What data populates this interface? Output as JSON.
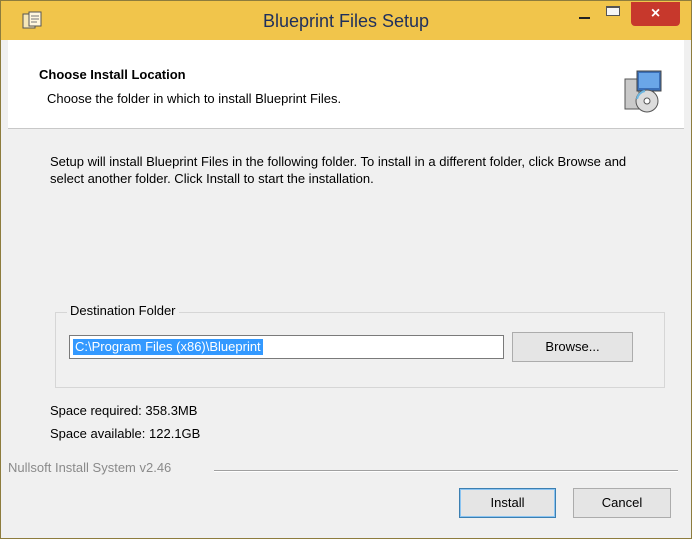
{
  "window": {
    "title": "Blueprint Files Setup",
    "close_glyph": "×",
    "icons": {
      "app": "installer-app-icon",
      "minimize": "minimize-icon",
      "maximize": "maximize-icon",
      "close": "close-icon"
    },
    "colors": {
      "titlebar": "#f1c54b",
      "close_button": "#c7382c"
    }
  },
  "header": {
    "title": "Choose Install Location",
    "subtitle": "Choose the folder in which to install Blueprint Files.",
    "icon": "installer-disk-icon"
  },
  "body": {
    "description": "Setup will install Blueprint Files in the following folder. To install in a different folder, click Browse and select another folder. Click Install to start the installation."
  },
  "destination": {
    "legend": "Destination Folder",
    "path_value": "C:\\Program Files (x86)\\Blueprint",
    "browse_label": "Browse..."
  },
  "space": {
    "required": "Space required: 358.3MB",
    "available": "Space available: 122.1GB"
  },
  "footer": {
    "branding": "Nullsoft Install System v2.46",
    "install_label": "Install",
    "cancel_label": "Cancel"
  }
}
